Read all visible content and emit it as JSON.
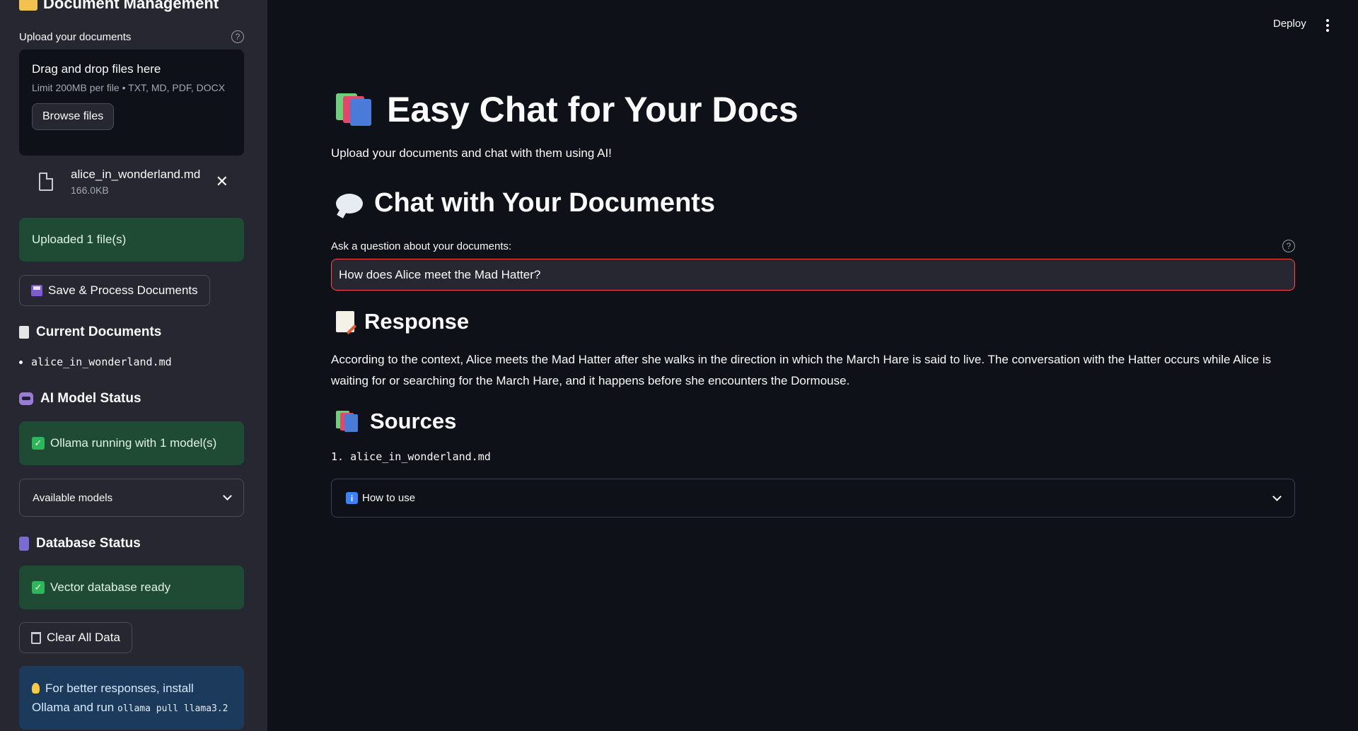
{
  "sidebar": {
    "title": "Document Management",
    "upload_label": "Upload your documents",
    "dropzone": {
      "title": "Drag and drop files here",
      "limit": "Limit 200MB per file • TXT, MD, PDF, DOCX",
      "browse_label": "Browse files"
    },
    "uploaded_file": {
      "name": "alice_in_wonderland.md",
      "size": "166.0KB"
    },
    "upload_status": "Uploaded 1 file(s)",
    "save_button": "Save & Process Documents",
    "current_documents": {
      "heading": "Current Documents",
      "items": [
        "alice_in_wonderland.md"
      ]
    },
    "ai_status": {
      "heading": "AI Model Status",
      "message": "Ollama running with 1 model(s)",
      "expander_label": "Available models"
    },
    "db_status": {
      "heading": "Database Status",
      "message": "Vector database ready"
    },
    "clear_button": "Clear All Data",
    "tip": {
      "text": "For better responses, install Ollama and run",
      "code": "ollama pull llama3.2"
    }
  },
  "header": {
    "deploy_label": "Deploy"
  },
  "main": {
    "title": "Easy Chat for Your Docs",
    "subtitle": "Upload your documents and chat with them using AI!",
    "chat_heading": "Chat with Your Documents",
    "question_label": "Ask a question about your documents:",
    "question_value": "How does Alice meet the Mad Hatter?",
    "response_heading": "Response",
    "response_text": "According to the context, Alice meets the Mad Hatter after she walks in the direction in which the March Hare is said to live. The conversation with the Hatter occurs while Alice is waiting for or searching for the March Hare, and it happens before she encounters the Dormouse.",
    "sources_heading": "Sources",
    "sources": [
      "1. alice_in_wonderland.md"
    ],
    "how_to_use_label": "How to use"
  },
  "colors": {
    "background": "#0e1117",
    "sidebar": "#262730",
    "success_bg": "#1f4a33",
    "info_bg": "#1b3a5c",
    "input_border": "#ff4b4b"
  }
}
